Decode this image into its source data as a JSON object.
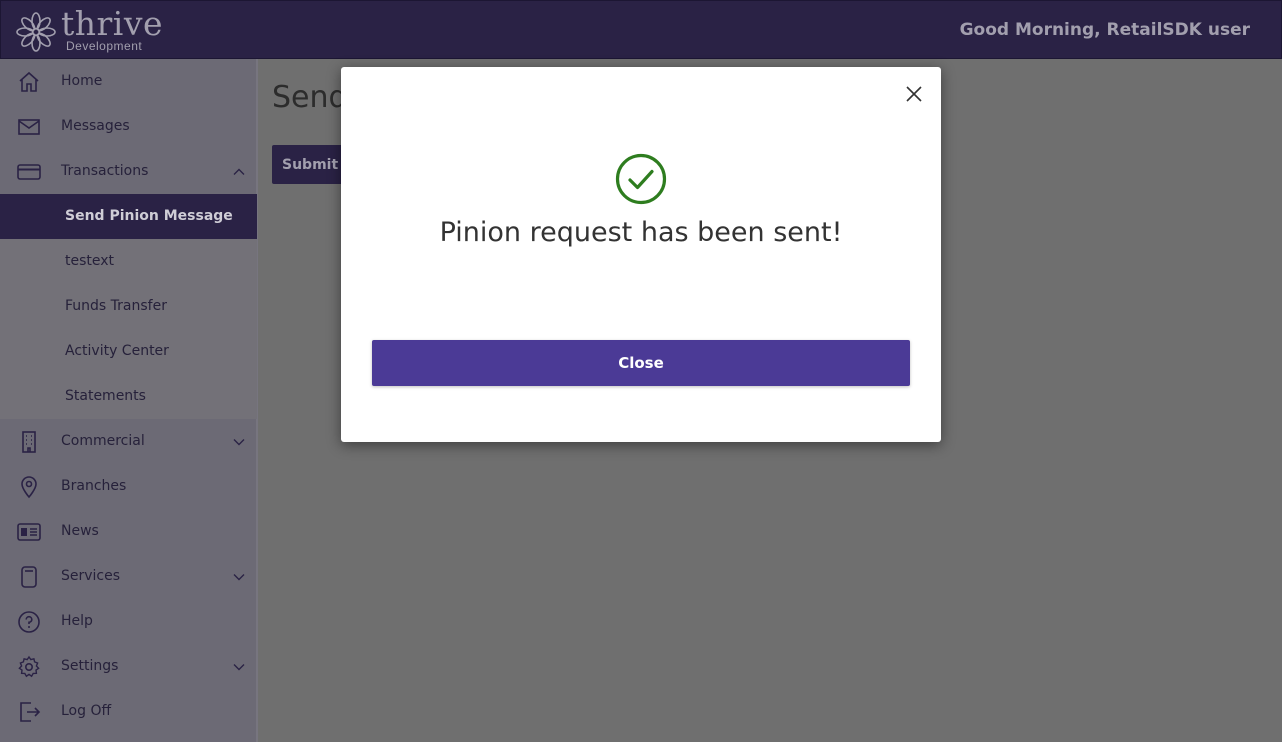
{
  "header": {
    "logo_text": "thrive",
    "logo_subtext": "Development",
    "greeting": "Good Morning, RetailSDK user"
  },
  "sidebar": {
    "items": [
      {
        "label": "Home",
        "icon": "home-icon"
      },
      {
        "label": "Messages",
        "icon": "envelope-icon"
      },
      {
        "label": "Transactions",
        "icon": "credit-card-icon",
        "expanded": true
      },
      {
        "label": "Commercial",
        "icon": "building-icon",
        "expanded": false
      },
      {
        "label": "Branches",
        "icon": "map-pin-icon"
      },
      {
        "label": "News",
        "icon": "newspaper-icon"
      },
      {
        "label": "Services",
        "icon": "device-icon",
        "expanded": false
      },
      {
        "label": "Help",
        "icon": "help-circle-icon"
      },
      {
        "label": "Settings",
        "icon": "gear-icon",
        "expanded": false
      },
      {
        "label": "Log Off",
        "icon": "logout-icon"
      }
    ],
    "transactions_sub": [
      {
        "label": "Send Pinion Message",
        "active": true
      },
      {
        "label": "testext"
      },
      {
        "label": "Funds Transfer"
      },
      {
        "label": "Activity Center"
      },
      {
        "label": "Statements"
      }
    ]
  },
  "main": {
    "title": "Send",
    "submit_label": "Submit"
  },
  "modal": {
    "message": "Pinion request has been sent!",
    "close_button_label": "Close"
  },
  "colors": {
    "header_bg": "#2a2245",
    "accent_button": "#4b3a96",
    "success_check": "#2e7d1f",
    "overlay": "#6f6f6f"
  }
}
